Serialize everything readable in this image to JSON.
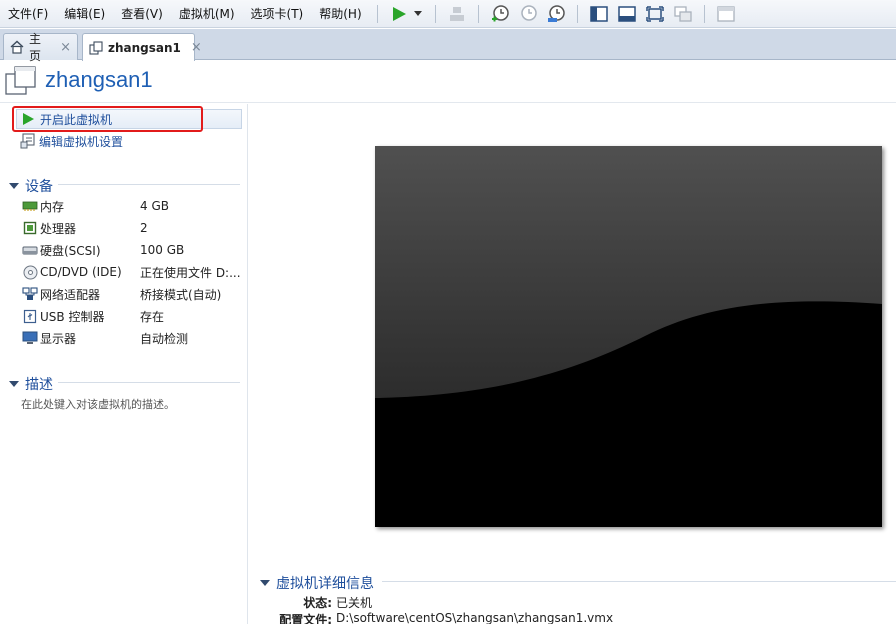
{
  "menu": {
    "file": "文件(F)",
    "edit": "编辑(E)",
    "view": "查看(V)",
    "vm": "虚拟机(M)",
    "tabs": "选项卡(T)",
    "help": "帮助(H)"
  },
  "tabs": [
    {
      "label": "主页",
      "active": false
    },
    {
      "label": "zhangsan1",
      "active": true
    }
  ],
  "tab_close_glyph": "×",
  "vm_name": "zhangsan1",
  "actions": {
    "start": "开启此虚拟机",
    "edit_settings": "编辑虚拟机设置"
  },
  "devices": {
    "section_title": "设备",
    "items": [
      {
        "name": "内存",
        "value": "4 GB",
        "icon": "memory-icon"
      },
      {
        "name": "处理器",
        "value": "2",
        "icon": "cpu-icon"
      },
      {
        "name": "硬盘(SCSI)",
        "value": "100 GB",
        "icon": "hard-disk-icon"
      },
      {
        "name": "CD/DVD (IDE)",
        "value": "正在使用文件 D:...",
        "icon": "cd-dvd-icon"
      },
      {
        "name": "网络适配器",
        "value": "桥接模式(自动)",
        "icon": "network-adapter-icon"
      },
      {
        "name": "USB 控制器",
        "value": "存在",
        "icon": "usb-icon"
      },
      {
        "name": "显示器",
        "value": "自动检测",
        "icon": "display-icon"
      }
    ]
  },
  "description": {
    "section_title": "描述",
    "placeholder": "在此处键入对该虚拟机的描述。"
  },
  "details": {
    "section_title": "虚拟机详细信息",
    "rows": [
      {
        "label": "状态:",
        "value": "已关机"
      },
      {
        "label": "配置文件:",
        "value": "D:\\software\\centOS\\zhangsan\\zhangsan1.vmx"
      }
    ]
  },
  "colors": {
    "accent": "#1f4f9c",
    "title": "#1e5fb4",
    "highlight": "#e21b1b",
    "play": "#2aa52a"
  }
}
